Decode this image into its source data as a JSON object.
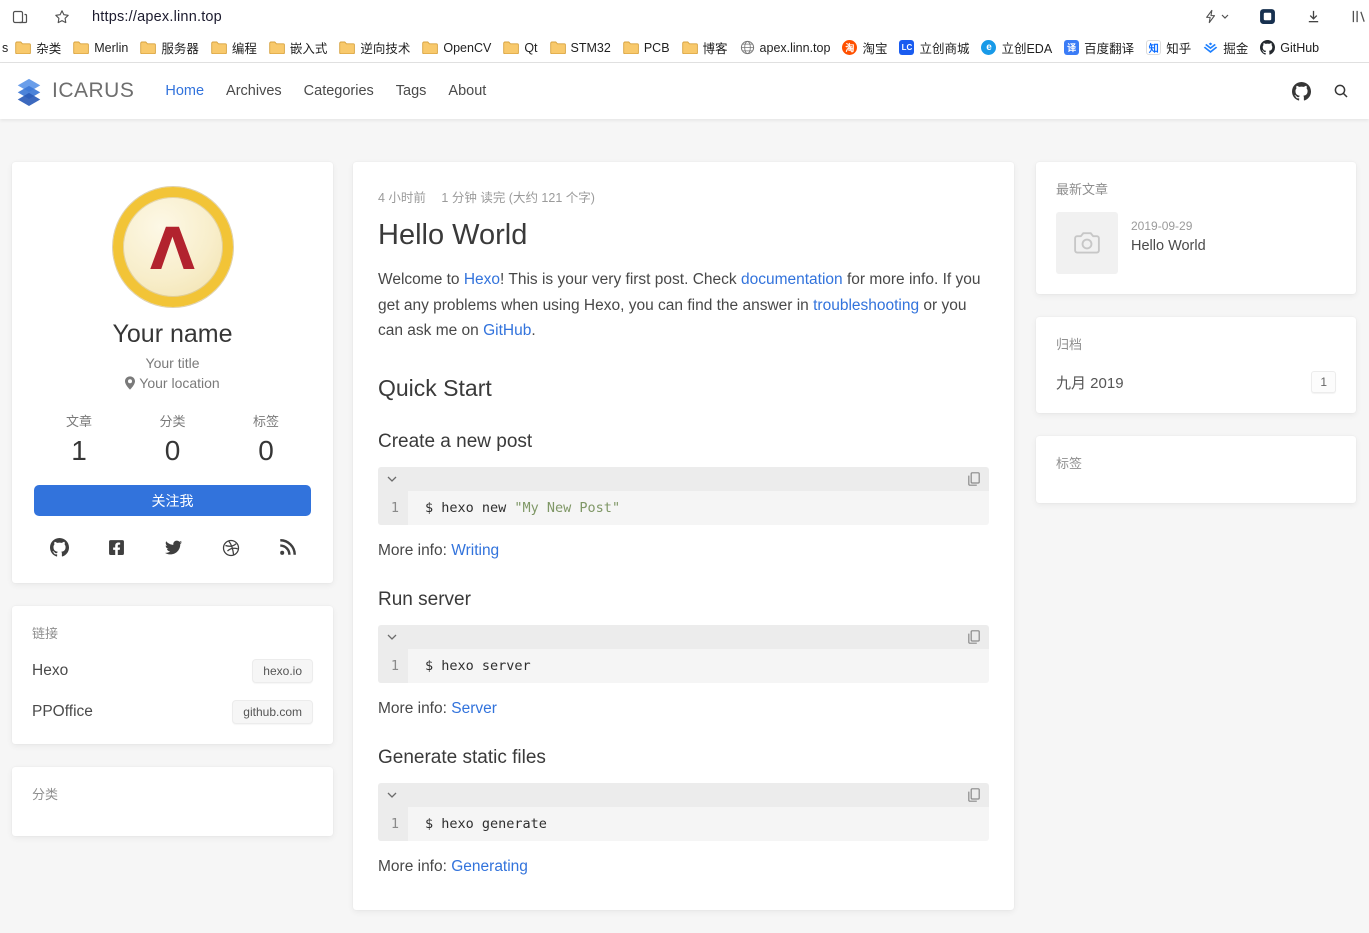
{
  "browser": {
    "url": "https://apex.linn.top",
    "clipped_bookmark": "s",
    "bookmarks": [
      {
        "label": "杂类",
        "icon": "folder"
      },
      {
        "label": "Merlin",
        "icon": "folder"
      },
      {
        "label": "服务器",
        "icon": "folder"
      },
      {
        "label": "编程",
        "icon": "folder"
      },
      {
        "label": "嵌入式",
        "icon": "folder"
      },
      {
        "label": "逆向技术",
        "icon": "folder"
      },
      {
        "label": "OpenCV",
        "icon": "folder"
      },
      {
        "label": "Qt",
        "icon": "folder"
      },
      {
        "label": "STM32",
        "icon": "folder"
      },
      {
        "label": "PCB",
        "icon": "folder"
      },
      {
        "label": "博客",
        "icon": "folder"
      },
      {
        "label": "apex.linn.top",
        "icon": "globe"
      },
      {
        "label": "淘宝",
        "icon": "taobao"
      },
      {
        "label": "立创商城",
        "icon": "lc"
      },
      {
        "label": "立创EDA",
        "icon": "eda"
      },
      {
        "label": "百度翻译",
        "icon": "baidu"
      },
      {
        "label": "知乎",
        "icon": "zhihu"
      },
      {
        "label": "掘金",
        "icon": "juejin"
      },
      {
        "label": "GitHub",
        "icon": "github"
      }
    ]
  },
  "navbar": {
    "brand": "ICARUS",
    "items": [
      {
        "label": "Home",
        "active": true
      },
      {
        "label": "Archives",
        "active": false
      },
      {
        "label": "Categories",
        "active": false
      },
      {
        "label": "Tags",
        "active": false
      },
      {
        "label": "About",
        "active": false
      }
    ]
  },
  "sidebar": {
    "profile": {
      "name": "Your name",
      "title": "Your title",
      "location": "Your location",
      "stats": [
        {
          "label": "文章",
          "value": "1"
        },
        {
          "label": "分类",
          "value": "0"
        },
        {
          "label": "标签",
          "value": "0"
        }
      ],
      "follow_label": "关注我",
      "social": [
        "github",
        "facebook",
        "twitter",
        "dribbble",
        "rss"
      ]
    },
    "links": {
      "header": "链接",
      "items": [
        {
          "label": "Hexo",
          "tag": "hexo.io"
        },
        {
          "label": "PPOffice",
          "tag": "github.com"
        }
      ]
    },
    "categories": {
      "header": "分类"
    }
  },
  "article": {
    "meta_time": "4 小时前",
    "meta_read": "1 分钟 读完 (大约 121 个字)",
    "title": "Hello World",
    "intro": [
      {
        "text": "Welcome to "
      },
      {
        "text": "Hexo",
        "link": true
      },
      {
        "text": "! This is your very first post. Check "
      },
      {
        "text": "documentation",
        "link": true
      },
      {
        "text": " for more info. If you get any problems when using Hexo, you can find the answer in "
      },
      {
        "text": "troubleshooting",
        "link": true
      },
      {
        "text": " or you can ask me on "
      },
      {
        "text": "GitHub",
        "link": true
      },
      {
        "text": "."
      }
    ],
    "quick_start_heading": "Quick Start",
    "line_no": "1",
    "sections": [
      {
        "heading": "Create a new post",
        "code": [
          {
            "text": "$ hexo new "
          },
          {
            "text": "\"My New Post\"",
            "string": true
          }
        ],
        "more_label": "More info: ",
        "more_link": "Writing"
      },
      {
        "heading": "Run server",
        "code": [
          {
            "text": "$ hexo server"
          }
        ],
        "more_label": "More info: ",
        "more_link": "Server"
      },
      {
        "heading": "Generate static files",
        "code": [
          {
            "text": "$ hexo generate"
          }
        ],
        "more_label": "More info: ",
        "more_link": "Generating"
      }
    ]
  },
  "widgets": {
    "recent": {
      "header": "最新文章",
      "items": [
        {
          "date": "2019-09-29",
          "title": "Hello World"
        }
      ]
    },
    "archives": {
      "header": "归档",
      "items": [
        {
          "label": "九月 2019",
          "count": "1"
        }
      ]
    },
    "tags": {
      "header": "标签"
    }
  },
  "colors": {
    "accent": "#3273dc",
    "string_token": "#7f9766",
    "avatar_ring": "#f2c437",
    "lambda_red": "#b2232e"
  }
}
